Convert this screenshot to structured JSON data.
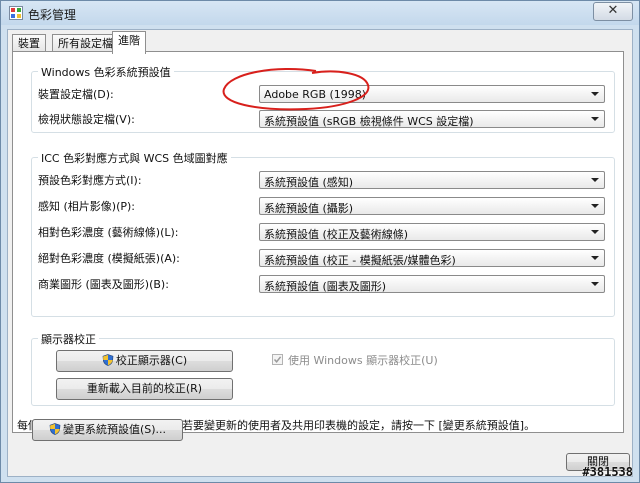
{
  "window": {
    "title": "色彩管理",
    "close_glyph": "✕"
  },
  "tabs": [
    {
      "label": "裝置",
      "active": false
    },
    {
      "label": "所有設定檔",
      "active": false
    },
    {
      "label": "進階",
      "active": true
    }
  ],
  "windows_defaults": {
    "title": "Windows 色彩系統預設值",
    "rows": [
      {
        "label": "裝置設定檔(D):",
        "value": "Adobe RGB (1998)"
      },
      {
        "label": "檢視狀態設定檔(V):",
        "value": "系統預設值 (sRGB 檢視條件 WCS 設定檔)"
      }
    ]
  },
  "icc_mapping": {
    "title": "ICC 色彩對應方式與 WCS 色域圖對應",
    "rows": [
      {
        "label": "預設色彩對應方式(I):",
        "value": "系統預設值 (感知)"
      },
      {
        "label": "感知 (相片影像)(P):",
        "value": "系統預設值 (攝影)"
      },
      {
        "label": "相對色彩濃度 (藝術線條)(L):",
        "value": "系統預設值 (校正及藝術線條)"
      },
      {
        "label": "絕對色彩濃度 (模擬紙張)(A):",
        "value": "系統預設值 (校正 - 模擬紙張/媒體色彩)"
      },
      {
        "label": "商業圖形 (圖表及圖形)(B):",
        "value": "系統預設值 (圖表及圖形)"
      }
    ]
  },
  "calibration": {
    "title": "顯示器校正",
    "calibrate_button": "校正顯示器(C)",
    "reload_button": "重新載入目前的校正(R)",
    "use_windows_calibration": "使用 Windows 顯示器校正(U)",
    "use_windows_calibration_checked": true
  },
  "footer": {
    "note": "每個使用者可個別儲存色彩設定。若要變更新的使用者及共用印表機的設定，請按一下 [變更系統預設值]。",
    "change_defaults_button": "變更系統預設值(S)...",
    "close_button": "關閉"
  },
  "watermark": "#381538",
  "colors": {
    "annotation_red": "#d8201c",
    "shield_blue": "#2f6fd1",
    "shield_yellow": "#f2c230"
  }
}
